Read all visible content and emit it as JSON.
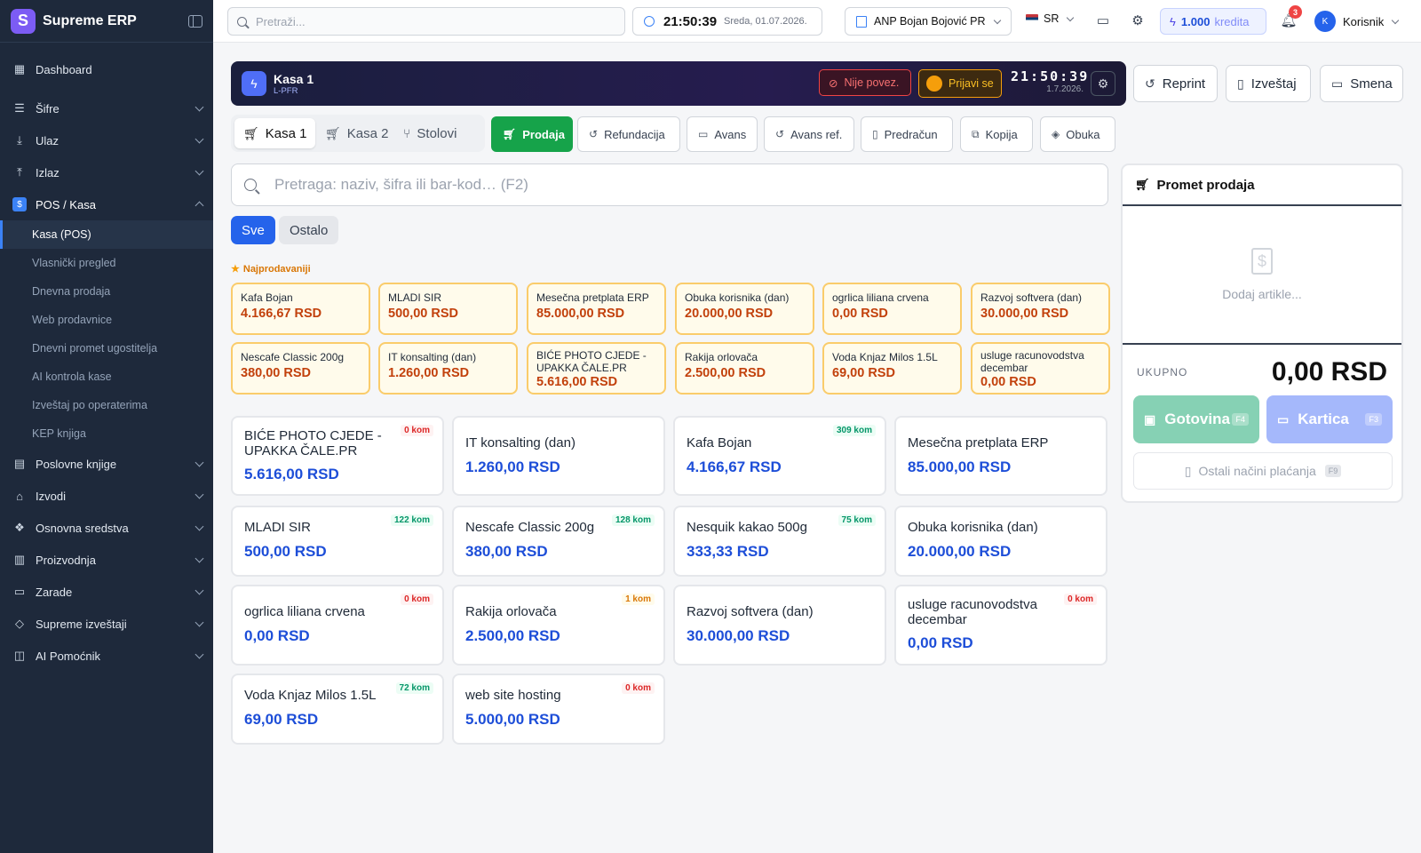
{
  "app": {
    "name": "Supreme ERP",
    "logo_letter": "S"
  },
  "topbar": {
    "search_placeholder": "Pretraži...",
    "time": "21:50:39",
    "date": "Sreda, 01.07.2026.",
    "company": "ANP Bojan Bojović PR",
    "language": "SR",
    "credits_value": "1.000",
    "credits_label": "kredita",
    "notifications_count": "3",
    "user_initial": "K",
    "user_name": "Korisnik"
  },
  "sidebar": {
    "dashboard": "Dashboard",
    "sections": [
      {
        "label": "Šifre"
      },
      {
        "label": "Ulaz"
      },
      {
        "label": "Izlaz"
      },
      {
        "label": "POS / Kasa"
      }
    ],
    "pos_sub": [
      {
        "label": "Kasa (POS)"
      },
      {
        "label": "Vlasnički pregled"
      },
      {
        "label": "Dnevna prodaja"
      },
      {
        "label": "Web prodavnice"
      },
      {
        "label": "Dnevni promet ugostitelja"
      },
      {
        "label": "AI kontrola kase"
      },
      {
        "label": "Izveštaj po operaterima"
      },
      {
        "label": "KEP knjiga"
      }
    ],
    "sections2": [
      {
        "label": "Poslovne knjige"
      },
      {
        "label": "Izvodi"
      },
      {
        "label": "Osnovna sredstva"
      },
      {
        "label": "Proizvodnja"
      },
      {
        "label": "Zarade"
      },
      {
        "label": "Supreme izveštaji"
      },
      {
        "label": "AI Pomoćnik"
      }
    ]
  },
  "kasa": {
    "title": "Kasa 1",
    "subtitle": "L-PFR",
    "status": "Nije povez.",
    "login": "Prijavi se",
    "time": "21:50:39",
    "date": "1.7.2026.",
    "actions": {
      "reprint": "Reprint",
      "report": "Izveštaj",
      "shift": "Smena"
    }
  },
  "register_tabs": [
    {
      "label": "Kasa 1"
    },
    {
      "label": "Kasa 2"
    },
    {
      "label": "Stolovi"
    }
  ],
  "operations": [
    {
      "label": "Prodaja"
    },
    {
      "label": "Refundacija"
    },
    {
      "label": "Avans"
    },
    {
      "label": "Avans ref."
    },
    {
      "label": "Predračun"
    },
    {
      "label": "Kopija"
    },
    {
      "label": "Obuka"
    }
  ],
  "product_search_placeholder": "Pretraga: naziv, šifra ili bar-kod… (F2)",
  "categories": [
    {
      "label": "Sve"
    },
    {
      "label": "Ostalo"
    }
  ],
  "bestsellers_label": "Najprodavaniji",
  "bestsellers": [
    {
      "name": "Kafa Bojan",
      "price": "4.166,67 RSD"
    },
    {
      "name": "MLADI SIR",
      "price": "500,00 RSD"
    },
    {
      "name": "Mesečna pretplata ERP",
      "price": "85.000,00 RSD"
    },
    {
      "name": "Obuka korisnika (dan)",
      "price": "20.000,00 RSD"
    },
    {
      "name": "ogrlica liliana crvena",
      "price": "0,00 RSD"
    },
    {
      "name": "Razvoj softvera (dan)",
      "price": "30.000,00 RSD"
    },
    {
      "name": "Nescafe Classic 200g",
      "price": "380,00 RSD"
    },
    {
      "name": "IT konsalting (dan)",
      "price": "1.260,00 RSD"
    },
    {
      "name": "BIĆE PHOTO CJEDE - UPAKKA ČALE.PR",
      "price": "5.616,00 RSD"
    },
    {
      "name": "Rakija orlovača",
      "price": "2.500,00 RSD"
    },
    {
      "name": "Voda Knjaz Milos 1.5L",
      "price": "69,00 RSD"
    },
    {
      "name": "usluge racunovodstva decembar",
      "price": "0,00 RSD"
    }
  ],
  "products": [
    {
      "name": "BIĆE PHOTO CJEDE - UPAKKA ČALE.PR",
      "price": "5.616,00 RSD",
      "stock": "0 kom",
      "stock_level": "zero"
    },
    {
      "name": "IT konsalting (dan)",
      "price": "1.260,00 RSD",
      "stock": "",
      "stock_level": ""
    },
    {
      "name": "Kafa Bojan",
      "price": "4.166,67 RSD",
      "stock": "309 kom",
      "stock_level": "ok"
    },
    {
      "name": "Mesečna pretplata ERP",
      "price": "85.000,00 RSD",
      "stock": "",
      "stock_level": ""
    },
    {
      "name": "MLADI SIR",
      "price": "500,00 RSD",
      "stock": "122 kom",
      "stock_level": "ok"
    },
    {
      "name": "Nescafe Classic 200g",
      "price": "380,00 RSD",
      "stock": "128 kom",
      "stock_level": "ok"
    },
    {
      "name": "Nesquik kakao 500g",
      "price": "333,33 RSD",
      "stock": "75 kom",
      "stock_level": "ok"
    },
    {
      "name": "Obuka korisnika (dan)",
      "price": "20.000,00 RSD",
      "stock": "",
      "stock_level": ""
    },
    {
      "name": "ogrlica liliana crvena",
      "price": "0,00 RSD",
      "stock": "0 kom",
      "stock_level": "zero"
    },
    {
      "name": "Rakija orlovača",
      "price": "2.500,00 RSD",
      "stock": "1 kom",
      "stock_level": "low"
    },
    {
      "name": "Razvoj softvera (dan)",
      "price": "30.000,00 RSD",
      "stock": "",
      "stock_level": ""
    },
    {
      "name": "usluge racunovodstva decembar",
      "price": "0,00 RSD",
      "stock": "0 kom",
      "stock_level": "zero"
    },
    {
      "name": "Voda Knjaz Milos 1.5L",
      "price": "69,00 RSD",
      "stock": "72 kom",
      "stock_level": "ok"
    },
    {
      "name": "web site hosting",
      "price": "5.000,00 RSD",
      "stock": "0 kom",
      "stock_level": "zero"
    }
  ],
  "cart": {
    "title": "Promet prodaja",
    "empty": "Dodaj artikle...",
    "total_label": "UKUPNO",
    "total_value": "0,00 RSD",
    "cash": "Gotovina",
    "cash_key": "F4",
    "card": "Kartica",
    "card_key": "F3",
    "other": "Ostali načini plaćanja",
    "other_key": "F9"
  },
  "colors": {
    "accent": "#2563eb",
    "sale": "#16a34a",
    "sidebar": "#1e293b",
    "price": "#1d4ed8",
    "bestseller_price": "#c2410c"
  }
}
